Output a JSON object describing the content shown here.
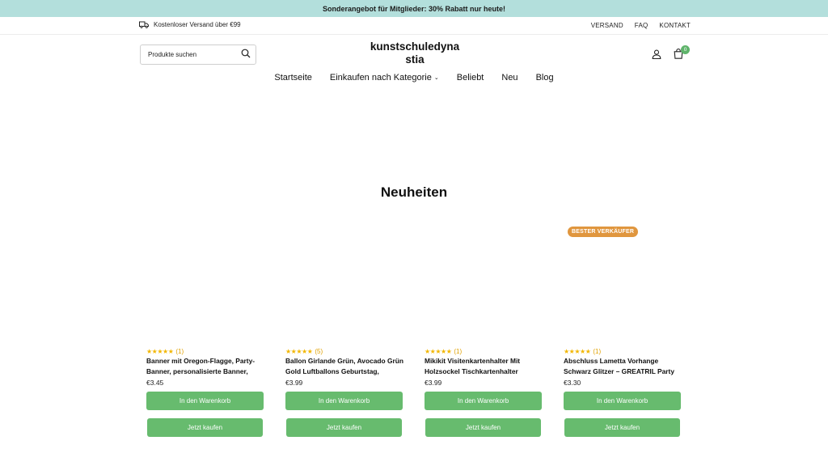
{
  "announcement": {
    "text": "Sonderangebot für Mitglieder: 30% Rabatt nur heute!"
  },
  "utility_bar": {
    "shipping_text": "Kostenloser Versand über €99",
    "links": [
      "VERSAND",
      "FAQ",
      "KONTAKT"
    ]
  },
  "header": {
    "search_placeholder": "Produkte suchen",
    "logo": "kunstschuledynastia",
    "cart_count": "0"
  },
  "nav": {
    "items": [
      "Startseite",
      "Einkaufen nach Kategorie",
      "Beliebt",
      "Neu",
      "Blog"
    ]
  },
  "section": {
    "title": "Neuheiten"
  },
  "products": [
    {
      "badge": "",
      "stars": "★★★★★",
      "rating_count": "(1)",
      "title": "Banner mit Oregon-Flagge, Party-Banner, personalisierte Banner, geeignet ...",
      "price": "€3.45",
      "add_to_cart": "In den Warenkorb",
      "buy_now": "Jetzt kaufen"
    },
    {
      "badge": "",
      "stars": "★★★★★",
      "rating_count": "(5)",
      "title": "Ballon Girlande Grün, Avocado Grün Gold Luftballons Geburtstag, Luftbal...",
      "price": "€3.99",
      "add_to_cart": "In den Warenkorb",
      "buy_now": "Jetzt kaufen"
    },
    {
      "badge": "",
      "stars": "★★★★★",
      "rating_count": "(1)",
      "title": "Mikikit Visitenkartenhalter Mit Holzsockel Tischkartenhalter Weihnachtskart...",
      "price": "€3.99",
      "add_to_cart": "In den Warenkorb",
      "buy_now": "Jetzt kaufen"
    },
    {
      "badge": "BESTER VERKÄUFER",
      "stars": "★★★★★",
      "rating_count": "(1)",
      "title": "Abschluss Lametta Vorhange Schwarz Glitzer – GREATRIL Party Luftschlan...",
      "price": "€3.30",
      "add_to_cart": "In den Warenkorb",
      "buy_now": "Jetzt kaufen"
    }
  ],
  "colors": {
    "announcement_bg": "#b3dfdc",
    "button_green": "#67bb6e",
    "badge_orange": "#e0963e",
    "star_yellow": "#f2b600"
  }
}
